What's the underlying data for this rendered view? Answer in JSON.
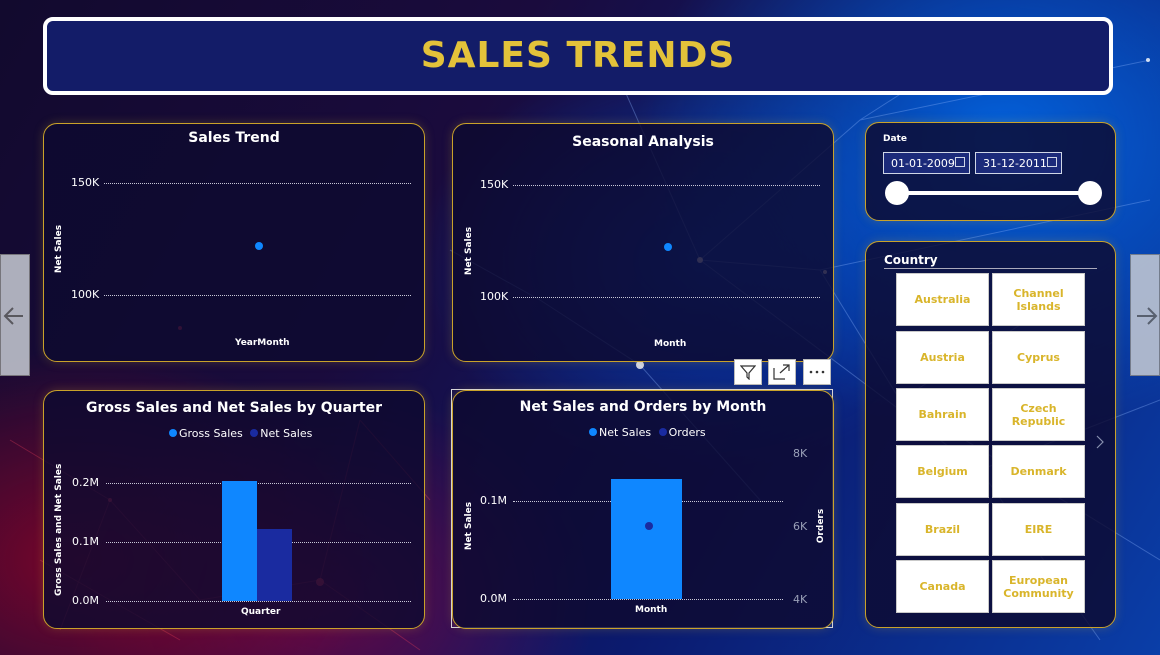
{
  "header": {
    "title": "SALES TRENDS"
  },
  "sales_trend": {
    "title": "Sales Trend",
    "ylabel": "Net Sales",
    "xlabel": "YearMonth",
    "ticks": [
      "150K",
      "100K"
    ],
    "chart_data": {
      "type": "scatter",
      "title": "Sales Trend",
      "xlabel": "YearMonth",
      "ylabel": "Net Sales",
      "yticks": [
        "100K",
        "150K"
      ],
      "points": [
        {
          "y": 122000
        }
      ]
    }
  },
  "seasonal": {
    "title": "Seasonal Analysis",
    "ylabel": "Net Sales",
    "xlabel": "Month",
    "ticks": [
      "150K",
      "100K"
    ],
    "chart_data": {
      "type": "scatter",
      "title": "Seasonal Analysis",
      "xlabel": "Month",
      "ylabel": "Net Sales",
      "yticks": [
        "100K",
        "150K"
      ],
      "points": [
        {
          "y": 122000
        }
      ]
    }
  },
  "gross_net": {
    "title": "Gross Sales and Net Sales by Quarter",
    "ylabel": "Gross Sales and Net Sales",
    "xlabel": "Quarter",
    "ticks": [
      "0.2M",
      "0.1M",
      "0.0M"
    ],
    "legend": [
      "Gross Sales",
      "Net Sales"
    ],
    "chart_data": {
      "type": "bar",
      "title": "Gross Sales and Net Sales by Quarter",
      "xlabel": "Quarter",
      "ylabel": "Gross Sales and Net Sales",
      "ylim": [
        0,
        0.2
      ],
      "yticks": [
        "0.0M",
        "0.1M",
        "0.2M"
      ],
      "categories": [
        ""
      ],
      "series": [
        {
          "name": "Gross Sales",
          "values": [
            0.204
          ]
        },
        {
          "name": "Net Sales",
          "values": [
            0.122
          ]
        }
      ]
    }
  },
  "net_orders": {
    "title": "Net Sales and Orders by Month",
    "ylabel": "Net Sales",
    "y2label": "Orders",
    "xlabel": "Month",
    "ticks": [
      "0.1M",
      "0.0M"
    ],
    "ticks2": [
      "8K",
      "6K",
      "4K"
    ],
    "legend": [
      "Net Sales",
      "Orders"
    ],
    "chart_data": {
      "type": "bar",
      "title": "Net Sales and Orders by Month",
      "xlabel": "Month",
      "ylabel": "Net Sales",
      "y2label": "Orders",
      "yticks": [
        "0.0M",
        "0.1M"
      ],
      "y2ticks": [
        "4K",
        "6K",
        "8K"
      ],
      "categories": [
        ""
      ],
      "series": [
        {
          "name": "Net Sales",
          "values": [
            0.122
          ],
          "axis": "left"
        },
        {
          "name": "Orders",
          "values": [
            6000
          ],
          "axis": "right",
          "type": "scatter"
        }
      ]
    }
  },
  "date_slicer": {
    "label": "Date",
    "start": "01-01-2009",
    "end": "31-12-2011"
  },
  "country": {
    "label": "Country",
    "items": [
      "Australia",
      "Channel Islands",
      "Austria",
      "Cyprus",
      "Bahrain",
      "Czech Republic",
      "Belgium",
      "Denmark",
      "Brazil",
      "EIRE",
      "Canada",
      "European Community"
    ]
  },
  "colors": {
    "title": "#e3c23a",
    "gross": "#0f87ff",
    "net": "#1a2ba0",
    "border": "#c9a22a",
    "tile_text": "#d9b52b"
  }
}
